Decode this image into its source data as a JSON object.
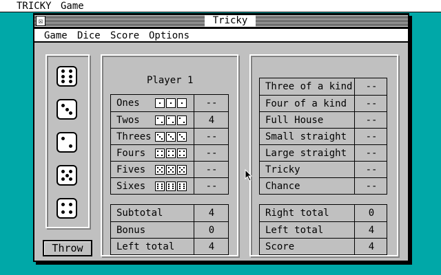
{
  "desktop_menu": {
    "app": "TRICKY",
    "game": "Game"
  },
  "window": {
    "title": "Tricky",
    "menu": [
      "Game",
      "Dice",
      "Score",
      "Options"
    ]
  },
  "dice": [
    6,
    3,
    2,
    5,
    4
  ],
  "throw_label": "Throw",
  "player": "Player 1",
  "upper": [
    {
      "label": "Ones",
      "face": 1,
      "value": "--"
    },
    {
      "label": "Twos",
      "face": 2,
      "value": "4"
    },
    {
      "label": "Threes",
      "face": 3,
      "value": "--"
    },
    {
      "label": "Fours",
      "face": 4,
      "value": "--"
    },
    {
      "label": "Fives",
      "face": 5,
      "value": "--"
    },
    {
      "label": "Sixes",
      "face": 6,
      "value": "--"
    }
  ],
  "left_totals": [
    {
      "label": "Subtotal",
      "value": "4"
    },
    {
      "label": "Bonus",
      "value": "0"
    },
    {
      "label": "Left total",
      "value": "4"
    }
  ],
  "lower": [
    {
      "label": "Three of a kind",
      "value": "--"
    },
    {
      "label": "Four of a kind",
      "value": "--"
    },
    {
      "label": "Full House",
      "value": "--"
    },
    {
      "label": "Small straight",
      "value": "--"
    },
    {
      "label": "Large straight",
      "value": "--"
    },
    {
      "label": "Tricky",
      "value": "--"
    },
    {
      "label": "Chance",
      "value": "--"
    }
  ],
  "right_totals": [
    {
      "label": "Right total",
      "value": "0"
    },
    {
      "label": "Left total",
      "value": "4"
    },
    {
      "label": "Score",
      "value": "4"
    }
  ]
}
